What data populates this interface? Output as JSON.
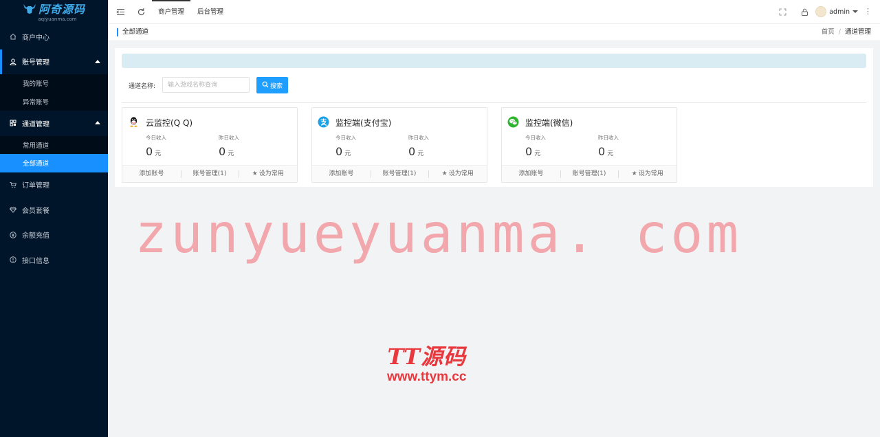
{
  "logo": {
    "title": "阿奇源码",
    "subtitle": "aqiyuanma.com"
  },
  "sidebar": {
    "items": [
      {
        "label": "商户中心",
        "icon": "home-icon"
      },
      {
        "label": "账号管理",
        "icon": "user-icon",
        "children": [
          "我的账号",
          "异常账号"
        ]
      },
      {
        "label": "通道管理",
        "icon": "grid-icon",
        "children": [
          "常用通道",
          "全部通道"
        ]
      },
      {
        "label": "订单管理",
        "icon": "cart-icon"
      },
      {
        "label": "会员套餐",
        "icon": "diamond-icon"
      },
      {
        "label": "余额充值",
        "icon": "coin-icon"
      },
      {
        "label": "接口信息",
        "icon": "info-icon"
      }
    ]
  },
  "header": {
    "tabs": [
      "商户管理",
      "后台管理"
    ],
    "user": "admin"
  },
  "breadcrumb": {
    "page_title": "全部通道",
    "home": "首页",
    "separator": "/",
    "current": "通道管理"
  },
  "search": {
    "label": "通道名称:",
    "placeholder": "输入游戏名称查询",
    "button": "搜索"
  },
  "cards": [
    {
      "title": "云监控(Q Q)",
      "icon": "qq-icon",
      "today_label": "今日收入",
      "today_value": "0",
      "yesterday_label": "昨日收入",
      "yesterday_value": "0",
      "unit": "元",
      "actions": [
        "添加账号",
        "账号管理(1)",
        "设为常用"
      ]
    },
    {
      "title": "监控端(支付宝)",
      "icon": "alipay-icon",
      "today_label": "今日收入",
      "today_value": "0",
      "yesterday_label": "昨日收入",
      "yesterday_value": "0",
      "unit": "元",
      "actions": [
        "添加账号",
        "账号管理(1)",
        "设为常用"
      ]
    },
    {
      "title": "监控端(微信)",
      "icon": "wechat-icon",
      "today_label": "今日收入",
      "today_value": "0",
      "yesterday_label": "昨日收入",
      "yesterday_value": "0",
      "unit": "元",
      "actions": [
        "添加账号",
        "账号管理(1)",
        "设为常用"
      ]
    }
  ],
  "watermarks": {
    "main": "zunyueyuanma. com",
    "brand": "TT源码",
    "url": "www.ttym.cc"
  },
  "colors": {
    "sidebar_bg": "#001529",
    "accent": "#1890ff",
    "search_button": "#1e9fff",
    "notice_bg": "#d9ecf4",
    "watermark_pink": "#f3a3aa",
    "watermark_red": "#e8383d"
  }
}
